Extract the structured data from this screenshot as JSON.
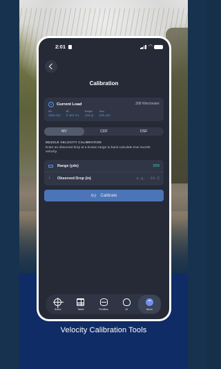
{
  "caption": "Velocity Calibration Tools",
  "status_bar": {
    "time": "2:01"
  },
  "page": {
    "title": "Calibration"
  },
  "current_load": {
    "label": "Current Load",
    "caliber": ".308 Winchester",
    "stats": [
      {
        "key": "MV",
        "value": "2650 fps"
      },
      {
        "key": "BC",
        "value": "0.462 G1"
      },
      {
        "key": "Weight",
        "value": "168 gr"
      },
      {
        "key": "Zero",
        "value": "200 yds"
      }
    ]
  },
  "segments": {
    "options": [
      "MV",
      "CDF",
      "DSF"
    ],
    "selected": "MV"
  },
  "section": {
    "heading": "MUZZLE VELOCITY CALIBRATION",
    "description": "Enter an observed drop at a known range to back-calculate true muzzle velocity."
  },
  "inputs": {
    "range": {
      "label": "Range (yds)",
      "value": "300"
    },
    "drop": {
      "label": "Observed Drop (in)",
      "placeholder": "e.g. -24.5"
    }
  },
  "calibrate_button": {
    "icon_text": "f(x)",
    "label": "Calibrate"
  },
  "tabs": [
    {
      "label": "Solve",
      "icon": "crosshair-icon"
    },
    {
      "label": "Table",
      "icon": "table-icon"
    },
    {
      "label": "Profiles",
      "icon": "database-icon"
    },
    {
      "label": "AI",
      "icon": "brain-icon"
    },
    {
      "label": "More",
      "icon": "more-icon",
      "active": true
    }
  ],
  "colors": {
    "accent": "#4a90e2",
    "value_green": "#44c3a4",
    "button": "#4c75b8",
    "screen_bg": "#252a36"
  }
}
